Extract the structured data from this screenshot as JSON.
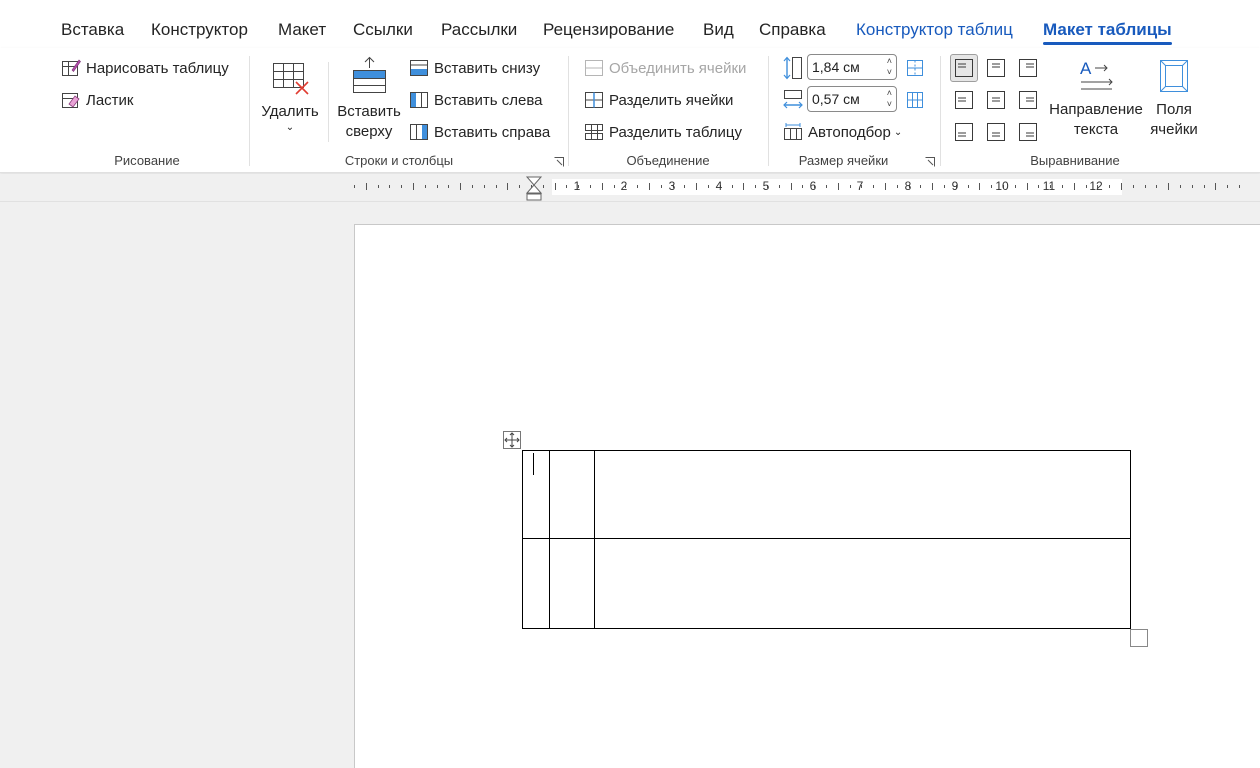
{
  "tabs": [
    {
      "label": "Вставка"
    },
    {
      "label": "Конструктор"
    },
    {
      "label": "Макет"
    },
    {
      "label": "Ссылки"
    },
    {
      "label": "Рассылки"
    },
    {
      "label": "Рецензирование"
    },
    {
      "label": "Вид"
    },
    {
      "label": "Справка"
    },
    {
      "label": "Конструктор таблиц"
    },
    {
      "label": "Макет таблицы"
    }
  ],
  "ribbon": {
    "drawing": {
      "group_label": "Рисование",
      "draw_table": "Нарисовать таблицу",
      "eraser": "Ластик"
    },
    "rows_cols": {
      "group_label": "Строки и столбцы",
      "delete": "Удалить",
      "insert_above_line1": "Вставить",
      "insert_above_line2": "сверху",
      "insert_below": "Вставить снизу",
      "insert_left": "Вставить слева",
      "insert_right": "Вставить справа"
    },
    "merge": {
      "group_label": "Объединение",
      "merge_cells": "Объединить ячейки",
      "split_cells": "Разделить ячейки",
      "split_table": "Разделить таблицу"
    },
    "cell_size": {
      "group_label": "Размер ячейки",
      "height_value": "1,84 см",
      "width_value": "0,57 см",
      "autofit": "Автоподбор"
    },
    "alignment": {
      "group_label": "Выравнивание",
      "text_direction_line1": "Направление",
      "text_direction_line2": "текста",
      "cell_margins_line1": "Поля",
      "cell_margins_line2": "ячейки",
      "selected": "top-left"
    }
  },
  "ruler": {
    "numbers": [
      "1",
      "2",
      "3",
      "4",
      "5",
      "6",
      "7",
      "8",
      "9",
      "10",
      "11",
      "12"
    ]
  },
  "colors": {
    "accent": "#185abd",
    "disabled": "#a6a6a6",
    "workspace": "#f0f0f0"
  }
}
